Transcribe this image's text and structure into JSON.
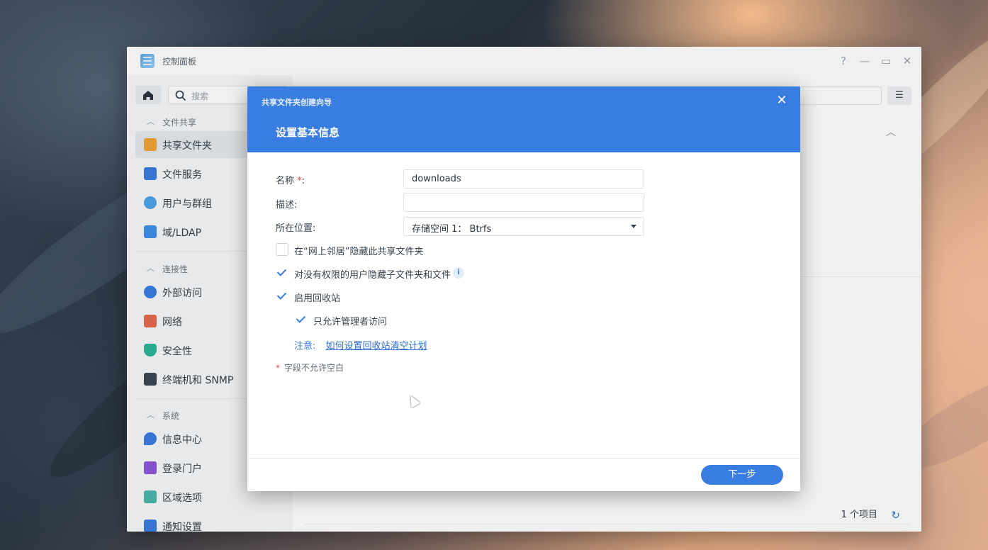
{
  "window": {
    "title": "控制面板",
    "help_icon": "?",
    "minimize_icon": "—",
    "maximize_icon": "▭",
    "close_icon": "✕"
  },
  "sidebar": {
    "search_placeholder": "搜索",
    "sections": [
      {
        "label": "文件共享",
        "items": [
          {
            "label": "共享文件夹",
            "icon": "shared-folder-icon",
            "active": true
          },
          {
            "label": "文件服务",
            "icon": "file-services-icon"
          },
          {
            "label": "用户与群组",
            "icon": "users-groups-icon"
          },
          {
            "label": "域/LDAP",
            "icon": "domain-ldap-icon"
          }
        ]
      },
      {
        "label": "连接性",
        "items": [
          {
            "label": "外部访问",
            "icon": "external-access-icon"
          },
          {
            "label": "网络",
            "icon": "network-icon"
          },
          {
            "label": "安全性",
            "icon": "security-shield-icon"
          },
          {
            "label": "终端机和 SNMP",
            "icon": "terminal-icon"
          }
        ]
      },
      {
        "label": "系统",
        "items": [
          {
            "label": "信息中心",
            "icon": "info-center-icon"
          },
          {
            "label": "登录门户",
            "icon": "login-portal-icon"
          },
          {
            "label": "区域选项",
            "icon": "regional-options-icon"
          },
          {
            "label": "通知设置",
            "icon": "notification-icon"
          }
        ]
      }
    ]
  },
  "content": {
    "item_count": "1 个项目"
  },
  "dialog": {
    "wizard_title": "共享文件夹创建向导",
    "step_title": "设置基本信息",
    "fields": {
      "name_label": "名称",
      "name_required": "*",
      "name_colon": ":",
      "name_value": "downloads",
      "desc_label": "描述:",
      "desc_value": "",
      "location_label": "所在位置:",
      "location_value": "存储空间 1：  Btrfs"
    },
    "options": {
      "hide_network": {
        "label": "在“网上邻居”隐藏此共享文件夹",
        "checked": false
      },
      "hide_subfolders": {
        "label": "对没有权限的用户隐藏子文件夹和文件",
        "checked": true
      },
      "recycle_bin": {
        "label": "启用回收站",
        "checked": true
      },
      "admin_only": {
        "label": "只允许管理者访问",
        "checked": true
      }
    },
    "note_key": "注意:",
    "note_link": "如何设置回收站清空计划",
    "required_note": "字段不允许空白",
    "required_star": "*",
    "next_button": "下一步",
    "close_icon": "✕"
  },
  "colors": {
    "accent": "#3a7de0",
    "required": "#e24b4b"
  }
}
